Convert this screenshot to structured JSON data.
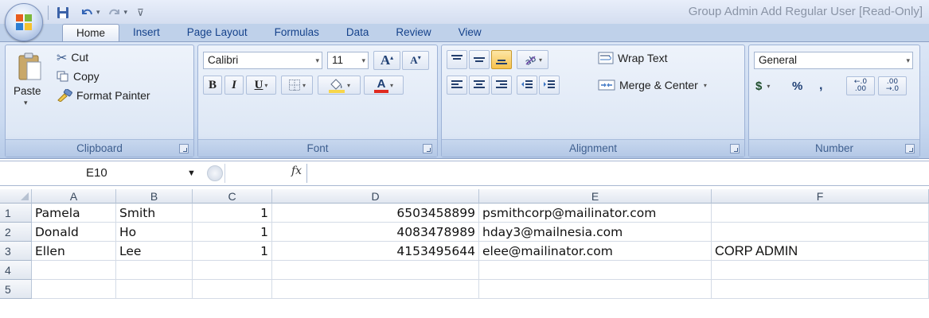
{
  "window": {
    "title": "Group Admin Add Regular User  [Read-Only]"
  },
  "tabs": [
    {
      "label": "Home",
      "active": true
    },
    {
      "label": "Insert"
    },
    {
      "label": "Page Layout"
    },
    {
      "label": "Formulas"
    },
    {
      "label": "Data"
    },
    {
      "label": "Review"
    },
    {
      "label": "View"
    }
  ],
  "ribbon": {
    "clipboard": {
      "label": "Clipboard",
      "paste": "Paste",
      "cut": "Cut",
      "copy": "Copy",
      "format_painter": "Format Painter"
    },
    "font": {
      "label": "Font",
      "name": "Calibri",
      "size": "11",
      "grow": "A",
      "shrink": "A",
      "bold": "B",
      "italic": "I",
      "underline": "U",
      "color_letter": "A"
    },
    "alignment": {
      "label": "Alignment",
      "wrap_text": "Wrap Text",
      "merge_center": "Merge & Center"
    },
    "number": {
      "label": "Number",
      "format": "General",
      "currency": "$",
      "percent": "%",
      "comma": ",",
      "inc_decimal_top": "←.0",
      "inc_decimal_bottom": ".00",
      "dec_decimal_top": ".00",
      "dec_decimal_bottom": "→.0"
    }
  },
  "formula_bar": {
    "name_box": "E10",
    "fx": "fx",
    "value": ""
  },
  "sheet": {
    "columns": [
      "A",
      "B",
      "C",
      "D",
      "E",
      "F"
    ],
    "rows": [
      {
        "num": "1",
        "cells": [
          "Pamela",
          "Smith",
          "1",
          "6503458899",
          "psmithcorp@mailinator.com",
          ""
        ]
      },
      {
        "num": "2",
        "cells": [
          "Donald",
          "Ho",
          "1",
          "4083478989",
          "hday3@mailnesia.com",
          ""
        ]
      },
      {
        "num": "3",
        "cells": [
          "Ellen",
          "Lee",
          "1",
          "4153495644",
          "elee@mailinator.com",
          "CORP ADMIN"
        ]
      },
      {
        "num": "4",
        "cells": [
          "",
          "",
          "",
          "",
          "",
          ""
        ]
      },
      {
        "num": "5",
        "cells": [
          "",
          "",
          "",
          "",
          "",
          ""
        ]
      }
    ]
  },
  "colors": {
    "tab_text": "#15428b",
    "group_label": "#3e5f8f",
    "fill_highlight": "#f7d64a",
    "font_color_bar": "#e02a1f"
  }
}
